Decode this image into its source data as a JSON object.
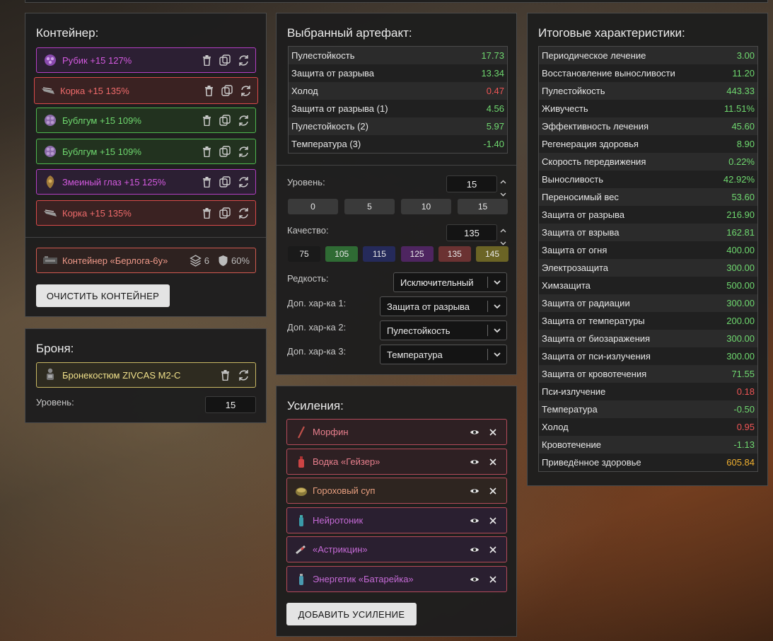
{
  "container_panel": {
    "title": "Контейнер:",
    "items": [
      {
        "label": "Рубик +15 127%",
        "color": "purple"
      },
      {
        "label": "Корка +15 135%",
        "color": "red"
      },
      {
        "label": "Бублгум +15 109%",
        "color": "green"
      },
      {
        "label": "Бублгум +15 109%",
        "color": "green"
      },
      {
        "label": "Змеиный глаз +15 125%",
        "color": "purple"
      },
      {
        "label": "Корка +15 135%",
        "color": "red"
      }
    ],
    "container": {
      "label": "Контейнер «Берлога-6у»",
      "slots": "6",
      "protection": "60%"
    },
    "clear_button": "ОЧИСТИТЬ КОНТЕЙНЕР"
  },
  "armor_panel": {
    "title": "Броня:",
    "armor": {
      "label": "Бронекостюм ZIVCAS M2-C"
    },
    "level_label": "Уровень:",
    "level_value": "15"
  },
  "artifact_panel": {
    "title": "Выбранный артефакт:",
    "stats": [
      {
        "name": "Пулестойкость",
        "value": "17.73",
        "sign": "pos"
      },
      {
        "name": "Защита от разрыва",
        "value": "13.34",
        "sign": "pos"
      },
      {
        "name": "Холод",
        "value": "0.47",
        "sign": "neg"
      },
      {
        "name": "Защита от разрыва (1)",
        "value": "4.56",
        "sign": "pos"
      },
      {
        "name": "Пулестойкость (2)",
        "value": "5.97",
        "sign": "pos"
      },
      {
        "name": "Температура (3)",
        "value": "-1.40",
        "sign": "pos"
      }
    ],
    "level_label": "Уровень:",
    "level_value": "15",
    "level_presets": [
      "0",
      "5",
      "10",
      "15"
    ],
    "quality_label": "Качество:",
    "quality_value": "135",
    "quality_presets": [
      {
        "label": "75",
        "color": "#1a1a1a"
      },
      {
        "label": "105",
        "color": "#2f6b34"
      },
      {
        "label": "115",
        "color": "#252a5a"
      },
      {
        "label": "125",
        "color": "#4e2560"
      },
      {
        "label": "135",
        "color": "#6b3232"
      },
      {
        "label": "145",
        "color": "#6b6425"
      }
    ],
    "rarity_label": "Редкость:",
    "rarity_value": "Исключительный",
    "extra1_label": "Доп. хар-ка 1:",
    "extra1_value": "Защита от разрыва",
    "extra2_label": "Доп. хар-ка 2:",
    "extra2_value": "Пулестойкость",
    "extra3_label": "Доп. хар-ка 3:",
    "extra3_value": "Температура"
  },
  "boosts_panel": {
    "title": "Усиления:",
    "items": [
      {
        "label": "Морфин",
        "color": "#e87f8d",
        "bg": "#2e2023"
      },
      {
        "label": "Водка «Гейзер»",
        "color": "#e87f8d",
        "bg": "#2e2023"
      },
      {
        "label": "Гороховый суп",
        "color": "#e89f7f",
        "bg": "#2e2520"
      },
      {
        "label": "Нейротоник",
        "color": "#c56ad6",
        "bg": "#2a1f30"
      },
      {
        "label": "«Астрикцин»",
        "color": "#c56ad6",
        "bg": "#2a1f30"
      },
      {
        "label": "Энергетик «Батарейка»",
        "color": "#c56ad6",
        "bg": "#2a1f30"
      }
    ],
    "add_button": "ДОБАВИТЬ УСИЛЕНИЕ"
  },
  "totals_panel": {
    "title": "Итоговые характеристики:",
    "stats": [
      {
        "name": "Периодическое лечение",
        "value": "3.00",
        "sign": "pos"
      },
      {
        "name": "Восстановление выносливости",
        "value": "11.20",
        "sign": "pos"
      },
      {
        "name": "Пулестойкость",
        "value": "443.33",
        "sign": "pos"
      },
      {
        "name": "Живучесть",
        "value": "11.51%",
        "sign": "pos"
      },
      {
        "name": "Эффективность лечения",
        "value": "45.60",
        "sign": "pos"
      },
      {
        "name": "Регенерация здоровья",
        "value": "8.90",
        "sign": "pos"
      },
      {
        "name": "Скорость передвижения",
        "value": "0.22%",
        "sign": "pos"
      },
      {
        "name": "Выносливость",
        "value": "42.92%",
        "sign": "pos"
      },
      {
        "name": "Переносимый вес",
        "value": "53.60",
        "sign": "pos"
      },
      {
        "name": "Защита от разрыва",
        "value": "216.90",
        "sign": "pos"
      },
      {
        "name": "Защита от взрыва",
        "value": "162.81",
        "sign": "pos"
      },
      {
        "name": "Защита от огня",
        "value": "400.00",
        "sign": "pos"
      },
      {
        "name": "Электрозащита",
        "value": "300.00",
        "sign": "pos"
      },
      {
        "name": "Химзащита",
        "value": "500.00",
        "sign": "pos"
      },
      {
        "name": "Защита от радиации",
        "value": "300.00",
        "sign": "pos"
      },
      {
        "name": "Защита от температуры",
        "value": "200.00",
        "sign": "pos"
      },
      {
        "name": "Защита от биозаражения",
        "value": "300.00",
        "sign": "pos"
      },
      {
        "name": "Защита от пси-излучения",
        "value": "300.00",
        "sign": "pos"
      },
      {
        "name": "Защита от кровотечения",
        "value": "71.55",
        "sign": "pos"
      },
      {
        "name": "Пси-излучение",
        "value": "0.18",
        "sign": "neg"
      },
      {
        "name": "Температура",
        "value": "-0.50",
        "sign": "pos"
      },
      {
        "name": "Холод",
        "value": "0.95",
        "sign": "neg"
      },
      {
        "name": "Кровотечение",
        "value": "-1.13",
        "sign": "pos"
      },
      {
        "name": "Приведённое здоровье",
        "value": "605.84",
        "sign": "gold"
      }
    ]
  }
}
